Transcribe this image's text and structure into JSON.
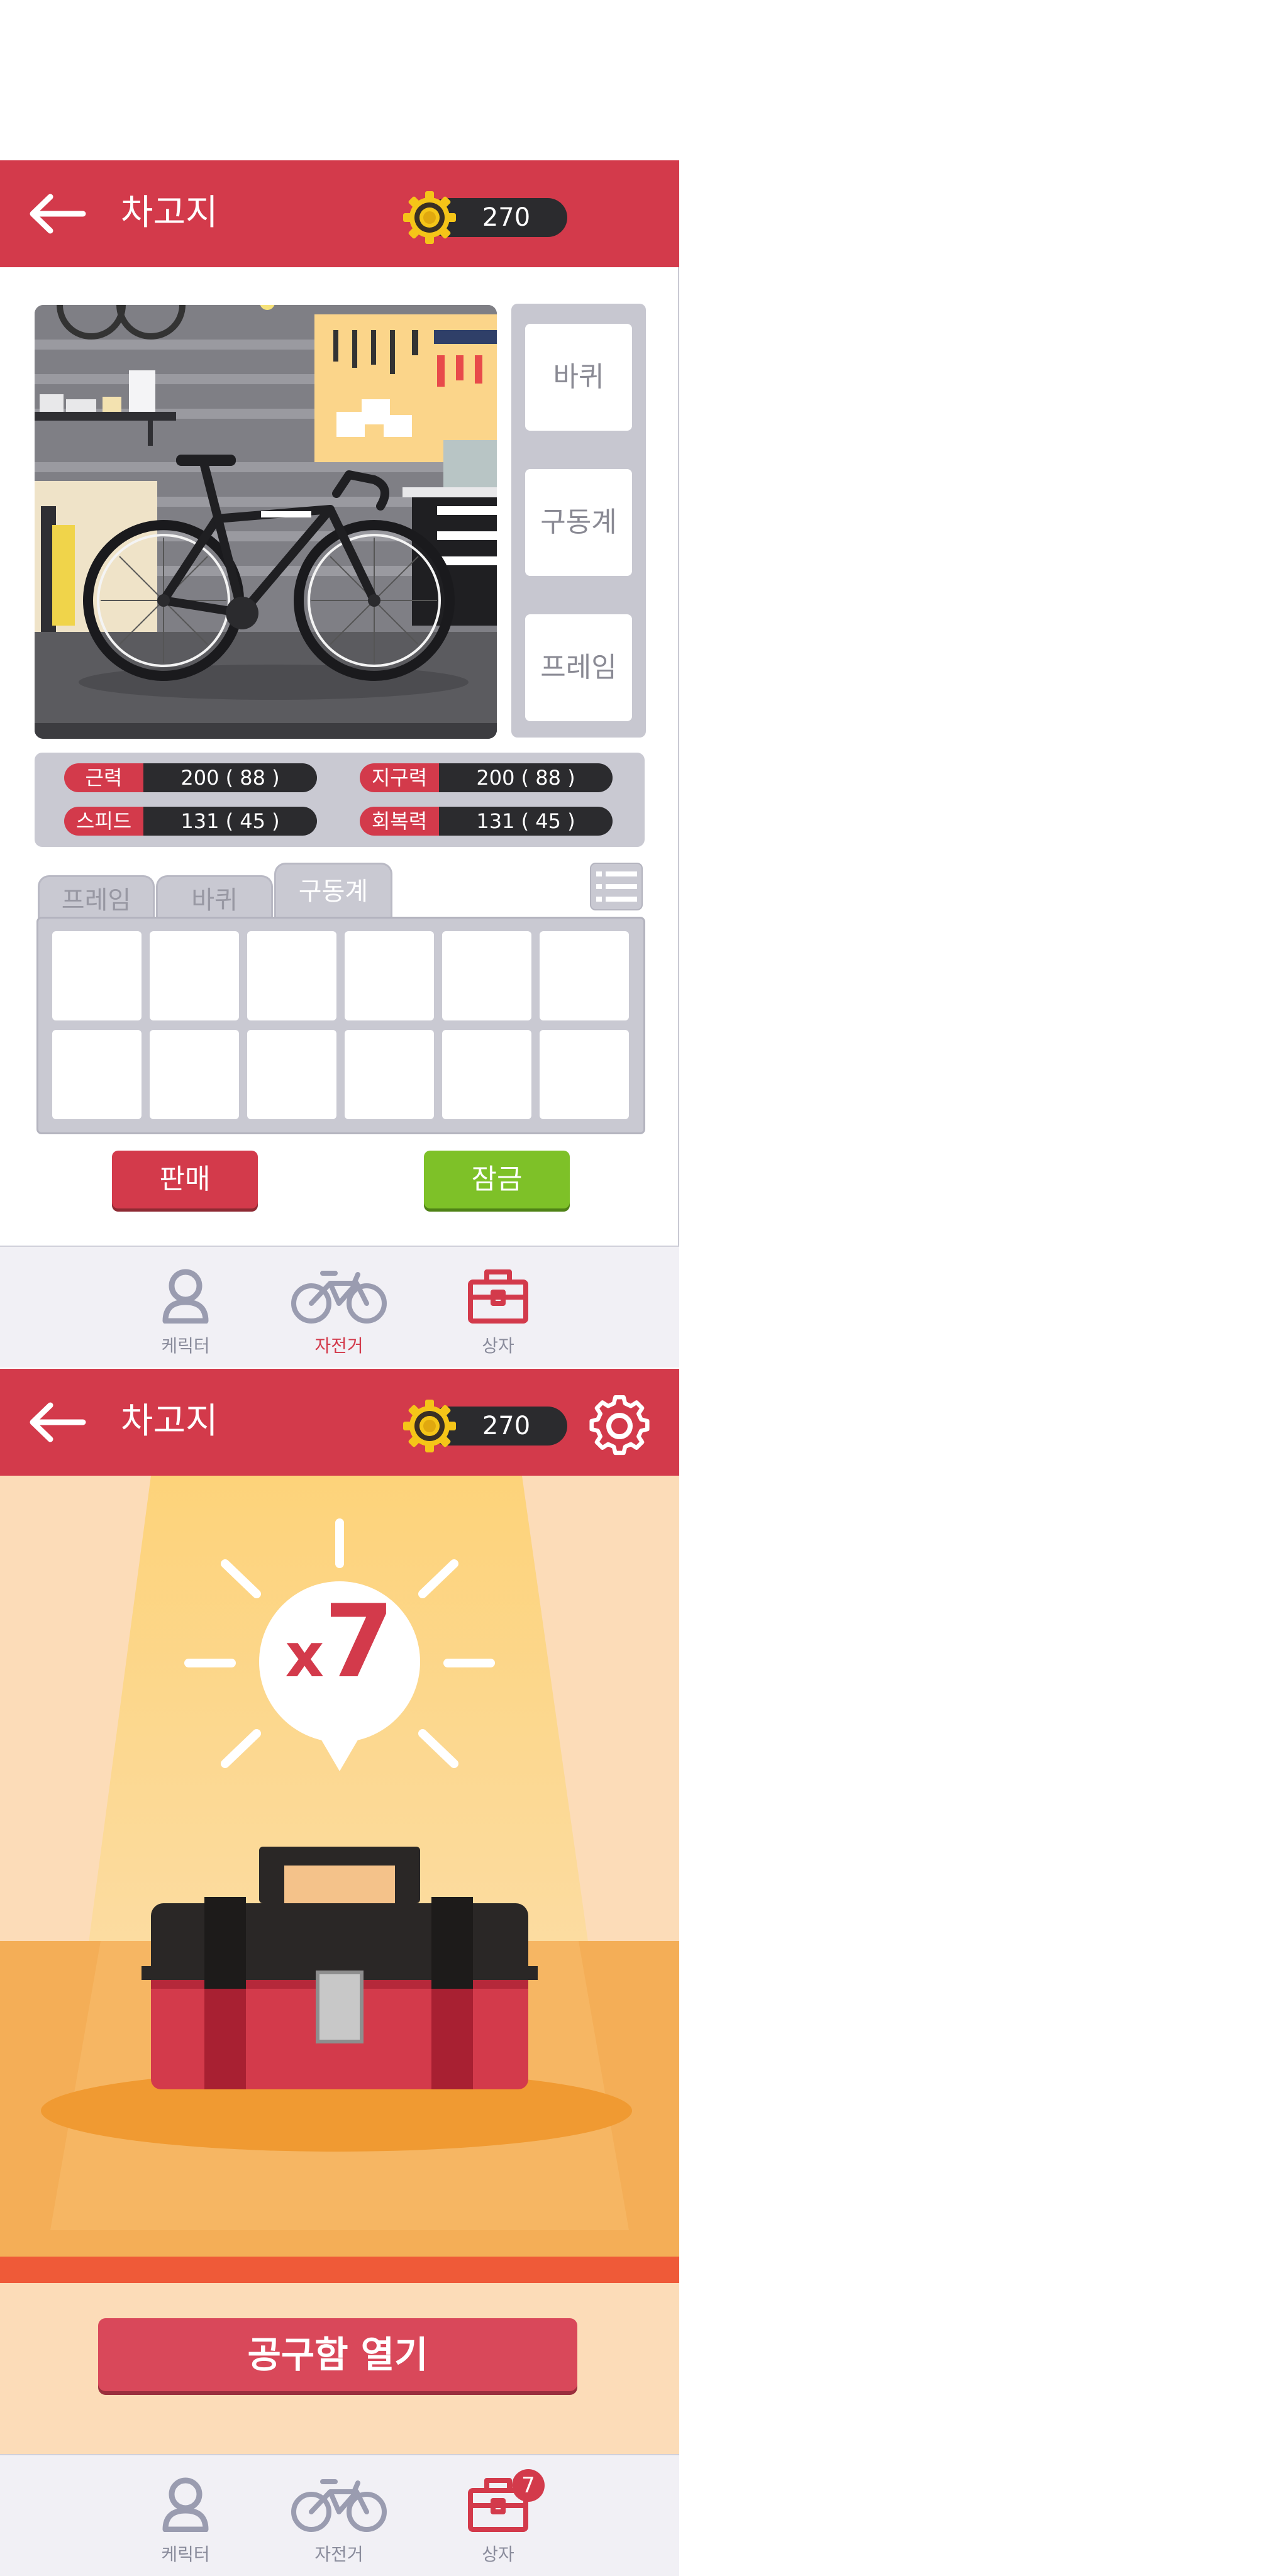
{
  "colors": {
    "brand_red": "#d33a4b",
    "pill_dark": "#2b2b2e",
    "panel_grey": "#c9c9d2",
    "lock_green": "#7ec128",
    "nav_bg": "#f1f0f5",
    "nav_label": "#8a8c9c",
    "toolbox_bg": "#fcdcb8",
    "toolbox_floor": "#f4ae57"
  },
  "screen_garage": {
    "header": {
      "back_icon": "arrow-left-icon",
      "title": "차고지",
      "currency_icon": "gear-coin-icon",
      "currency_value": "270"
    },
    "side_slots": [
      {
        "label": "바퀴"
      },
      {
        "label": "구동계"
      },
      {
        "label": "프레임"
      }
    ],
    "stats": [
      {
        "label": "근력",
        "value": "200 ( 88 )"
      },
      {
        "label": "지구력",
        "value": "200 ( 88 )"
      },
      {
        "label": "스피드",
        "value": "131 ( 45 )"
      },
      {
        "label": "회복력",
        "value": "131 ( 45 )"
      }
    ],
    "tabs": [
      {
        "label": "프레임",
        "active": false
      },
      {
        "label": "바퀴",
        "active": false
      },
      {
        "label": "구동계",
        "active": true
      }
    ],
    "list_icon": "list-view-icon",
    "inventory_slots": 12,
    "sell_label": "판매",
    "lock_label": "잠금",
    "bottom_nav": [
      {
        "label": "케릭터",
        "icon": "character-icon",
        "active": false
      },
      {
        "label": "자전거",
        "icon": "bicycle-icon",
        "active": true
      },
      {
        "label": "상자",
        "icon": "toolbox-icon",
        "active": false
      }
    ]
  },
  "screen_toolbox": {
    "header": {
      "back_icon": "arrow-left-icon",
      "title": "차고지",
      "currency_icon": "gear-coin-icon",
      "currency_value": "270",
      "settings_icon": "settings-gear-icon"
    },
    "multiplier_prefix": "x",
    "multiplier_value": "7",
    "open_button": "공구함 열기",
    "bottom_nav": [
      {
        "label": "케릭터",
        "icon": "character-icon",
        "active": false
      },
      {
        "label": "자전거",
        "icon": "bicycle-icon",
        "active": false
      },
      {
        "label": "상자",
        "icon": "toolbox-icon",
        "active": false,
        "badge": "7"
      }
    ]
  }
}
